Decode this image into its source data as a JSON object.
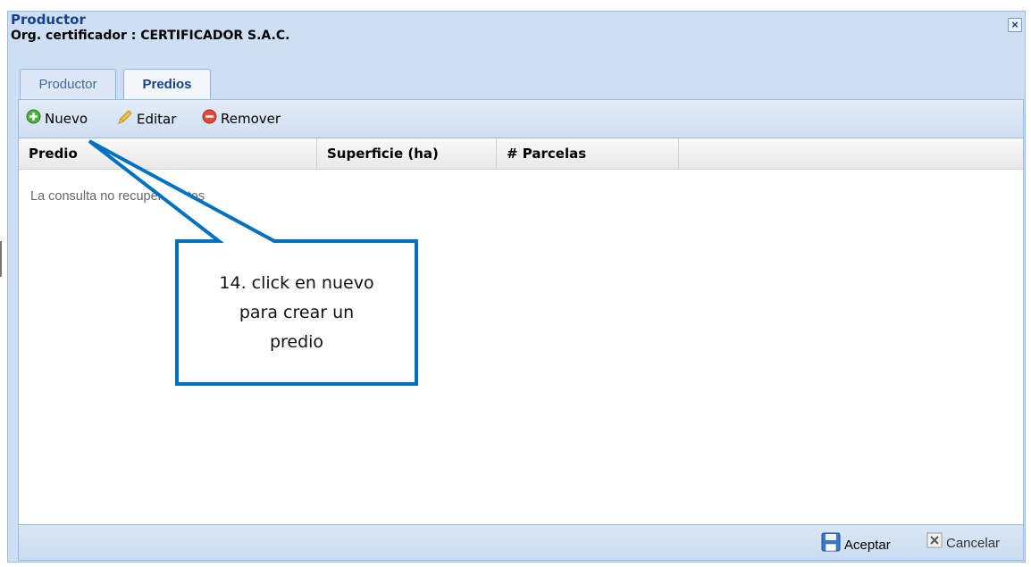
{
  "window": {
    "title": "Productor",
    "subtitle": "Org. certificador : CERTIFICADOR S.A.C.",
    "close_glyph": "×"
  },
  "tabs": [
    {
      "label": "Productor",
      "active": false
    },
    {
      "label": "Predios",
      "active": true
    }
  ],
  "toolbar": {
    "new_label": "Nuevo",
    "new_icon": "add-circle-icon",
    "edit_label": "Editar",
    "edit_icon": "pencil-icon",
    "remove_label": "Remover",
    "remove_icon": "remove-circle-icon"
  },
  "grid": {
    "columns": [
      "Predio",
      "Superficie (ha)",
      "# Parcelas"
    ],
    "rows": [],
    "empty_message": "La consulta no recuperó datos"
  },
  "footer": {
    "accept_label": "Aceptar",
    "accept_icon": "save-icon",
    "cancel_label": "Cancelar",
    "cancel_icon": "close-icon"
  },
  "callout": {
    "lines": [
      "14. click en nuevo",
      "para crear un",
      "predio"
    ],
    "border_color": "#0070c0"
  },
  "colors": {
    "header_blue": "#15428b",
    "window_bg": "#cfdff3",
    "border": "#99bbe8"
  }
}
